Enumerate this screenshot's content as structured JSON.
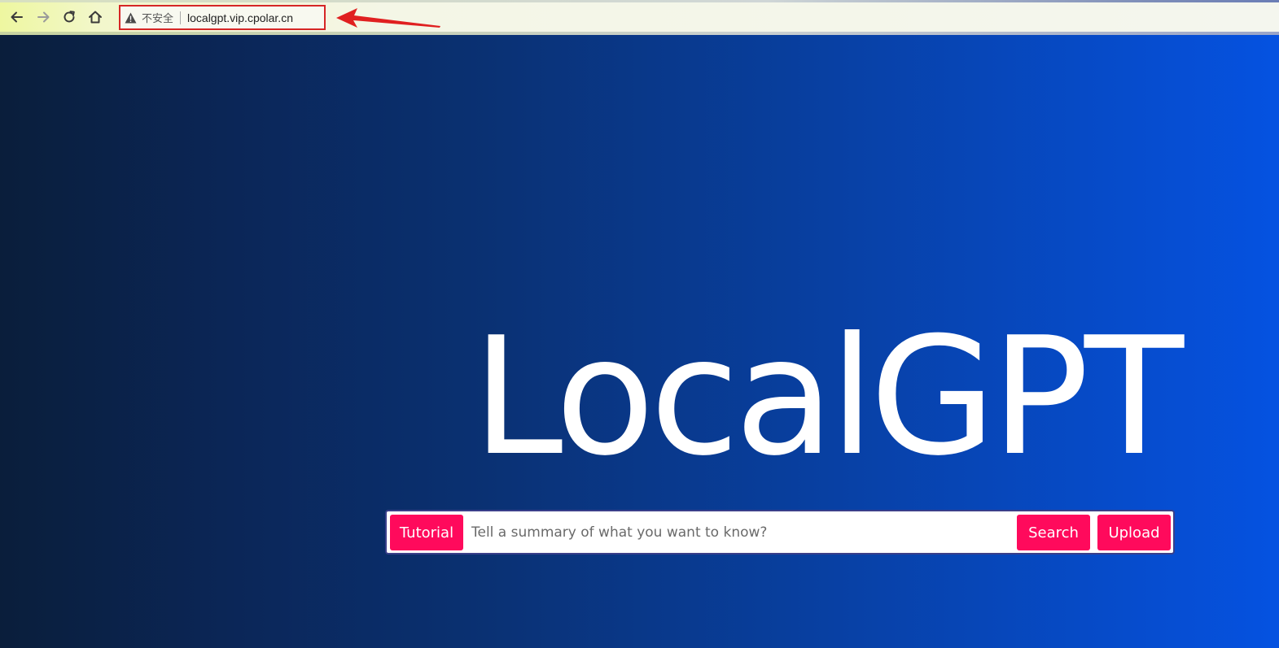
{
  "browser": {
    "security_label": "不安全",
    "url": "localgpt.vip.cpolar.cn",
    "icons": {
      "back": "arrow-left-icon",
      "forward": "arrow-right-icon",
      "reload": "reload-icon",
      "home": "home-icon",
      "warning": "warning-triangle-icon"
    }
  },
  "annotation": {
    "color": "#e02020"
  },
  "page": {
    "title": "LocalGPT",
    "buttons": {
      "tutorial": "Tutorial",
      "search": "Search",
      "upload": "Upload"
    },
    "search_placeholder": "Tell a summary of what you want to know?",
    "accent_color": "#ff0a5c"
  }
}
